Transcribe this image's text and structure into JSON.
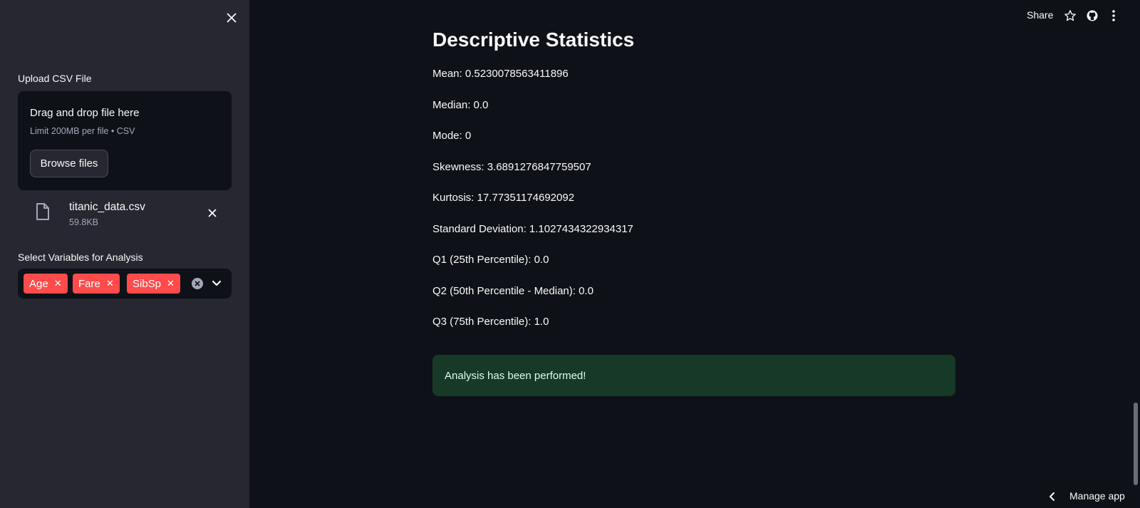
{
  "sidebar": {
    "upload_label": "Upload CSV File",
    "uploader": {
      "title": "Drag and drop file here",
      "limit": "Limit 200MB per file • CSV",
      "browse_label": "Browse files"
    },
    "file": {
      "name": "titanic_data.csv",
      "size": "59.8KB"
    },
    "select_label": "Select Variables for Analysis",
    "selected_tags": [
      "Age",
      "Fare",
      "SibSp"
    ]
  },
  "toolbar": {
    "share_label": "Share"
  },
  "main": {
    "title": "Descriptive Statistics",
    "stats": [
      "Mean: 0.5230078563411896",
      "Median: 0.0",
      "Mode: 0",
      "Skewness: 3.6891276847759507",
      "Kurtosis: 17.77351174692092",
      "Standard Deviation: 1.1027434322934317",
      "Q1 (25th Percentile): 0.0",
      "Q2 (50th Percentile - Median): 0.0",
      "Q3 (75th Percentile): 1.0"
    ],
    "success_message": "Analysis has been performed!"
  },
  "footer": {
    "manage_label": "Manage app"
  },
  "colors": {
    "background": "#0e1117",
    "sidebar": "#262730",
    "tag": "#ff4b4b",
    "success_bg": "#173928"
  }
}
